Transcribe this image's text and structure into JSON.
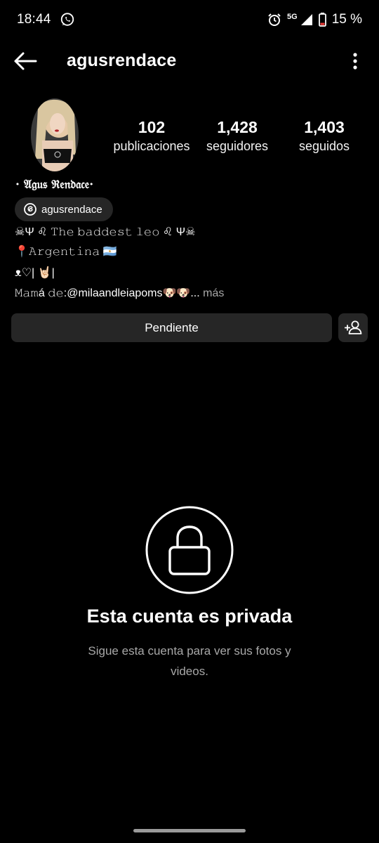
{
  "status_bar": {
    "time": "18:44",
    "network": "5G",
    "battery": "15 %",
    "icons": [
      "whatsapp-icon",
      "alarm-icon",
      "signal-icon",
      "battery-icon"
    ]
  },
  "header": {
    "username": "agusrendace",
    "icons": [
      "back-arrow-icon",
      "more-vertical-icon"
    ]
  },
  "profile": {
    "stats": [
      {
        "value": "102",
        "label": "publicaciones"
      },
      {
        "value": "1,428",
        "label": "seguidores"
      },
      {
        "value": "1,403",
        "label": "seguidos"
      }
    ],
    "full_name": "· 𝔄𝔤𝔲𝔰 ℜ𝔢𝔫𝔡𝔞𝔠𝔢·",
    "threads_handle": "agusrendace",
    "bio": {
      "line1": "☠︎Ψ ♌︎ 𝚃𝚑𝚎 𝚋𝚊𝚍𝚍𝚎𝚜𝚝 𝚕𝚎𝚘 ♌︎ Ψ☠︎",
      "line2": "📍𝙰𝚛𝚐𝚎𝚗𝚝𝚒𝚗𝚊 🇦🇷",
      "line3": "ᴥ♡| 🤘🏻|",
      "line4_prefix": "𝙼𝚊𝚖á 𝚍𝚎:",
      "line4_mention": "@milaandleiapoms🐶🐶...",
      "more": "más"
    }
  },
  "actions": {
    "pending_label": "Pendiente",
    "add_user_icon": "add-person-icon"
  },
  "private": {
    "title": "Esta cuenta es privada",
    "subtitle": "Sigue esta cuenta para ver sus fotos y videos."
  },
  "colors": {
    "background": "#000000",
    "button_bg": "#262626",
    "secondary_text": "#a8a8a8"
  }
}
